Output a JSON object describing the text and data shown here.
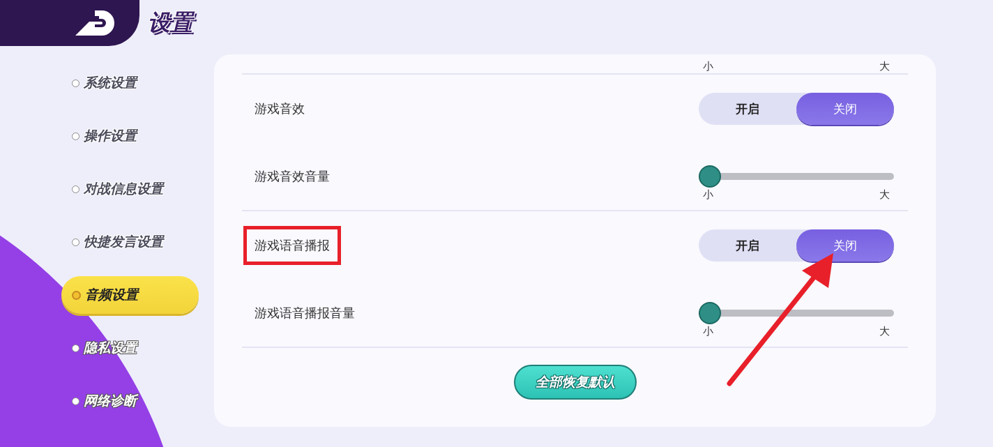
{
  "header": {
    "title": "设置"
  },
  "sidebar": {
    "items": [
      {
        "label": "系统设置",
        "selected": false
      },
      {
        "label": "操作设置",
        "selected": false
      },
      {
        "label": "对战信息设置",
        "selected": false
      },
      {
        "label": "快捷发言设置",
        "selected": false
      },
      {
        "label": "音频设置",
        "selected": true
      },
      {
        "label": "隐私设置",
        "selected": false
      },
      {
        "label": "网络诊断",
        "selected": false
      }
    ]
  },
  "settings": {
    "scrolled_scale": {
      "min_label": "小",
      "max_label": "大"
    },
    "rows": [
      {
        "kind": "toggle",
        "label": "游戏音效",
        "highlighted": false,
        "options": [
          {
            "label": "开启",
            "selected": false
          },
          {
            "label": "关闭",
            "selected": true
          }
        ]
      },
      {
        "kind": "slider",
        "label": "游戏音效音量",
        "highlighted": false,
        "level": 0,
        "min_label": "小",
        "max_label": "大"
      },
      {
        "kind": "toggle",
        "label": "游戏语音播报",
        "highlighted": true,
        "options": [
          {
            "label": "开启",
            "selected": false
          },
          {
            "label": "关闭",
            "selected": true
          }
        ]
      },
      {
        "kind": "slider",
        "label": "游戏语音播报音量",
        "highlighted": false,
        "level": 0,
        "min_label": "小",
        "max_label": "大"
      }
    ],
    "reset_button": "全部恢复默认"
  }
}
